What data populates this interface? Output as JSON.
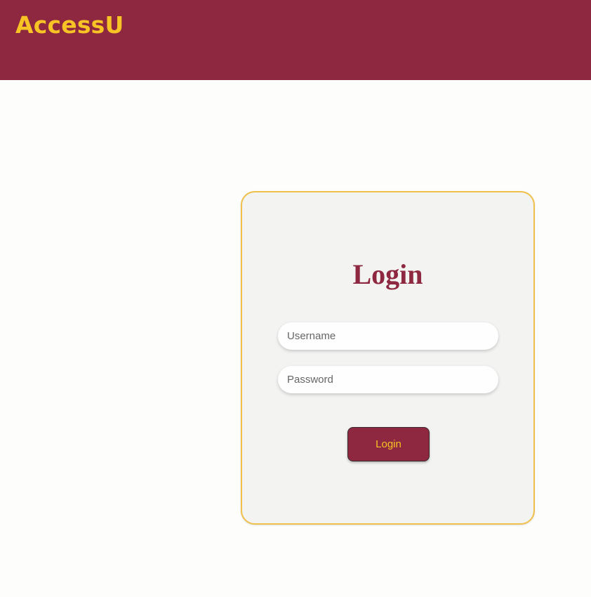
{
  "header": {
    "brand": "AccessU"
  },
  "login_card": {
    "title": "Login",
    "username_placeholder": "Username",
    "password_placeholder": "Password",
    "submit_label": "Login"
  },
  "colors": {
    "brand_maroon": "#8e2840",
    "brand_gold": "#f7c325",
    "card_border_gold": "#efc04a",
    "card_background": "#f3f3f2",
    "page_background": "#fdfdfb"
  }
}
